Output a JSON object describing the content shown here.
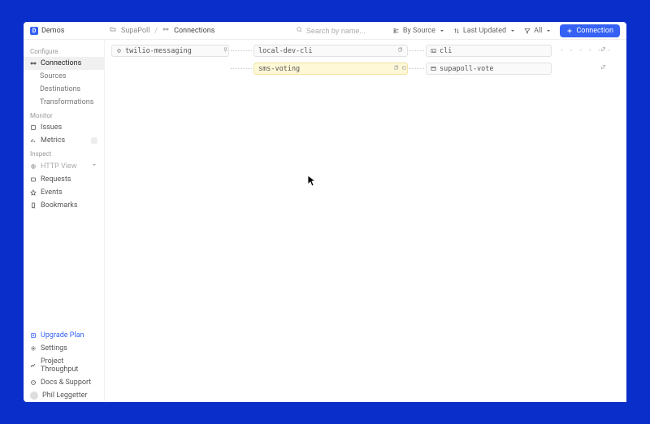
{
  "brand": {
    "name": "Demos",
    "logo_letter": "D"
  },
  "breadcrumb": {
    "project": "SupaPoll",
    "current": "Connections"
  },
  "search": {
    "placeholder": "Search by name..."
  },
  "toolbar": {
    "group_label": "By Source",
    "sort_label": "Last Updated",
    "filter_label": "All",
    "primary_label": "Connection"
  },
  "sidebar": {
    "sections": [
      {
        "label": "Configure",
        "items": [
          {
            "label": "Connections",
            "icon": "connections",
            "active": true
          },
          {
            "label": "Sources",
            "sub": true
          },
          {
            "label": "Destinations",
            "sub": true
          },
          {
            "label": "Transformations",
            "sub": true
          }
        ]
      },
      {
        "label": "Monitor",
        "items": [
          {
            "label": "Issues",
            "icon": "issues"
          },
          {
            "label": "Metrics",
            "icon": "metrics",
            "badge": ""
          }
        ]
      },
      {
        "label": "Inspect",
        "items": [
          {
            "label": "HTTP View",
            "icon": "http",
            "caret": true,
            "disabled": true
          },
          {
            "label": "Requests",
            "icon": "requests"
          },
          {
            "label": "Events",
            "icon": "events"
          },
          {
            "label": "Bookmarks",
            "icon": "bookmarks"
          }
        ]
      }
    ],
    "footer": [
      {
        "label": "Upgrade Plan",
        "icon": "upgrade",
        "accent": true
      },
      {
        "label": "Settings",
        "icon": "settings"
      },
      {
        "label": "Project Throughput",
        "icon": "throughput"
      },
      {
        "label": "Docs & Support",
        "icon": "docs"
      },
      {
        "label": "Phil Leggetter",
        "icon": "avatar"
      }
    ]
  },
  "canvas": {
    "sources": [
      {
        "name": "twilio-messaging"
      }
    ],
    "edges_top": [
      {
        "name": "local-dev-cli"
      },
      {
        "name": "sms-voting"
      }
    ],
    "dests": [
      {
        "name": "cli"
      },
      {
        "name": "supapoll-vote"
      }
    ]
  }
}
